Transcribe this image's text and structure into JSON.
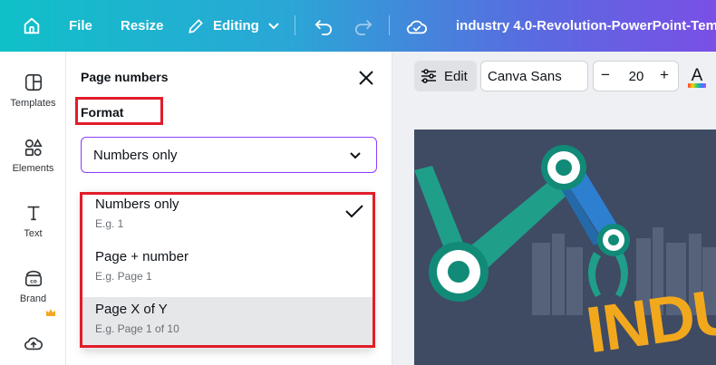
{
  "topbar": {
    "file_label": "File",
    "resize_label": "Resize",
    "editing_label": "Editing",
    "doc_title": "industry 4.0-Revolution-PowerPoint-Tem..."
  },
  "rail": {
    "items": [
      {
        "label": "Templates",
        "icon": "templates-icon"
      },
      {
        "label": "Elements",
        "icon": "elements-icon"
      },
      {
        "label": "Text",
        "icon": "text-icon"
      },
      {
        "label": "Brand",
        "icon": "brand-icon"
      },
      {
        "label": "",
        "icon": "upload-icon"
      }
    ]
  },
  "panel": {
    "title": "Page numbers",
    "format_label": "Format",
    "selected_value": "Numbers only",
    "options": [
      {
        "title": "Numbers only",
        "example": "E.g. 1",
        "checked": true
      },
      {
        "title": "Page + number",
        "example": "E.g. Page 1",
        "checked": false
      },
      {
        "title": "Page X of Y",
        "example": "E.g. Page 1 of 10",
        "checked": false
      }
    ]
  },
  "toolbar": {
    "edit_label": "Edit",
    "font_name": "Canva Sans",
    "font_size": "20",
    "minus": "−",
    "plus": "+",
    "text_color_letter": "A"
  },
  "slide": {
    "partial_text": "INDU"
  },
  "colors": {
    "highlight_box": "#e11d2a",
    "accent": "#8b3dff",
    "slide_bg": "#3f4a63",
    "robot_teal": "#1f9e8a",
    "text_orange": "#f2a81d"
  }
}
